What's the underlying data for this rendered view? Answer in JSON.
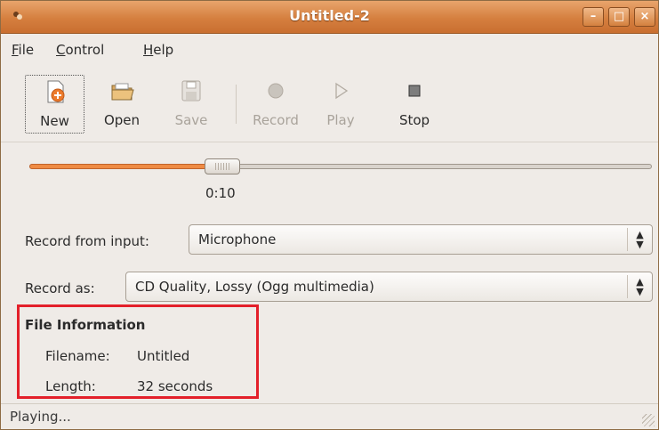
{
  "window": {
    "title": "Untitled-2",
    "buttons": {
      "minimize": "–",
      "maximize": "□",
      "close": "×"
    }
  },
  "menu": [
    {
      "mnemonic": "F",
      "rest": "ile"
    },
    {
      "mnemonic": "C",
      "rest": "ontrol"
    },
    {
      "mnemonic": "H",
      "rest": "elp"
    }
  ],
  "toolbar": {
    "new": "New",
    "open": "Open",
    "save": "Save",
    "record": "Record",
    "play": "Play",
    "stop": "Stop"
  },
  "playback": {
    "time": "0:10",
    "position_fraction": 0.31
  },
  "record_from": {
    "label": "Record from input:",
    "value": "Microphone"
  },
  "record_as": {
    "label": "Record as:",
    "value": "CD Quality, Lossy (Ogg multimedia)"
  },
  "file_info": {
    "heading": "File Information",
    "filename_label": "Filename:",
    "filename_value": "Untitled",
    "length_label": "Length:",
    "length_value": "32 seconds"
  },
  "status": "Playing...",
  "colors": {
    "titlebar": "#d57f3f",
    "accent": "#ef8b44",
    "highlight": "#e3202a"
  }
}
